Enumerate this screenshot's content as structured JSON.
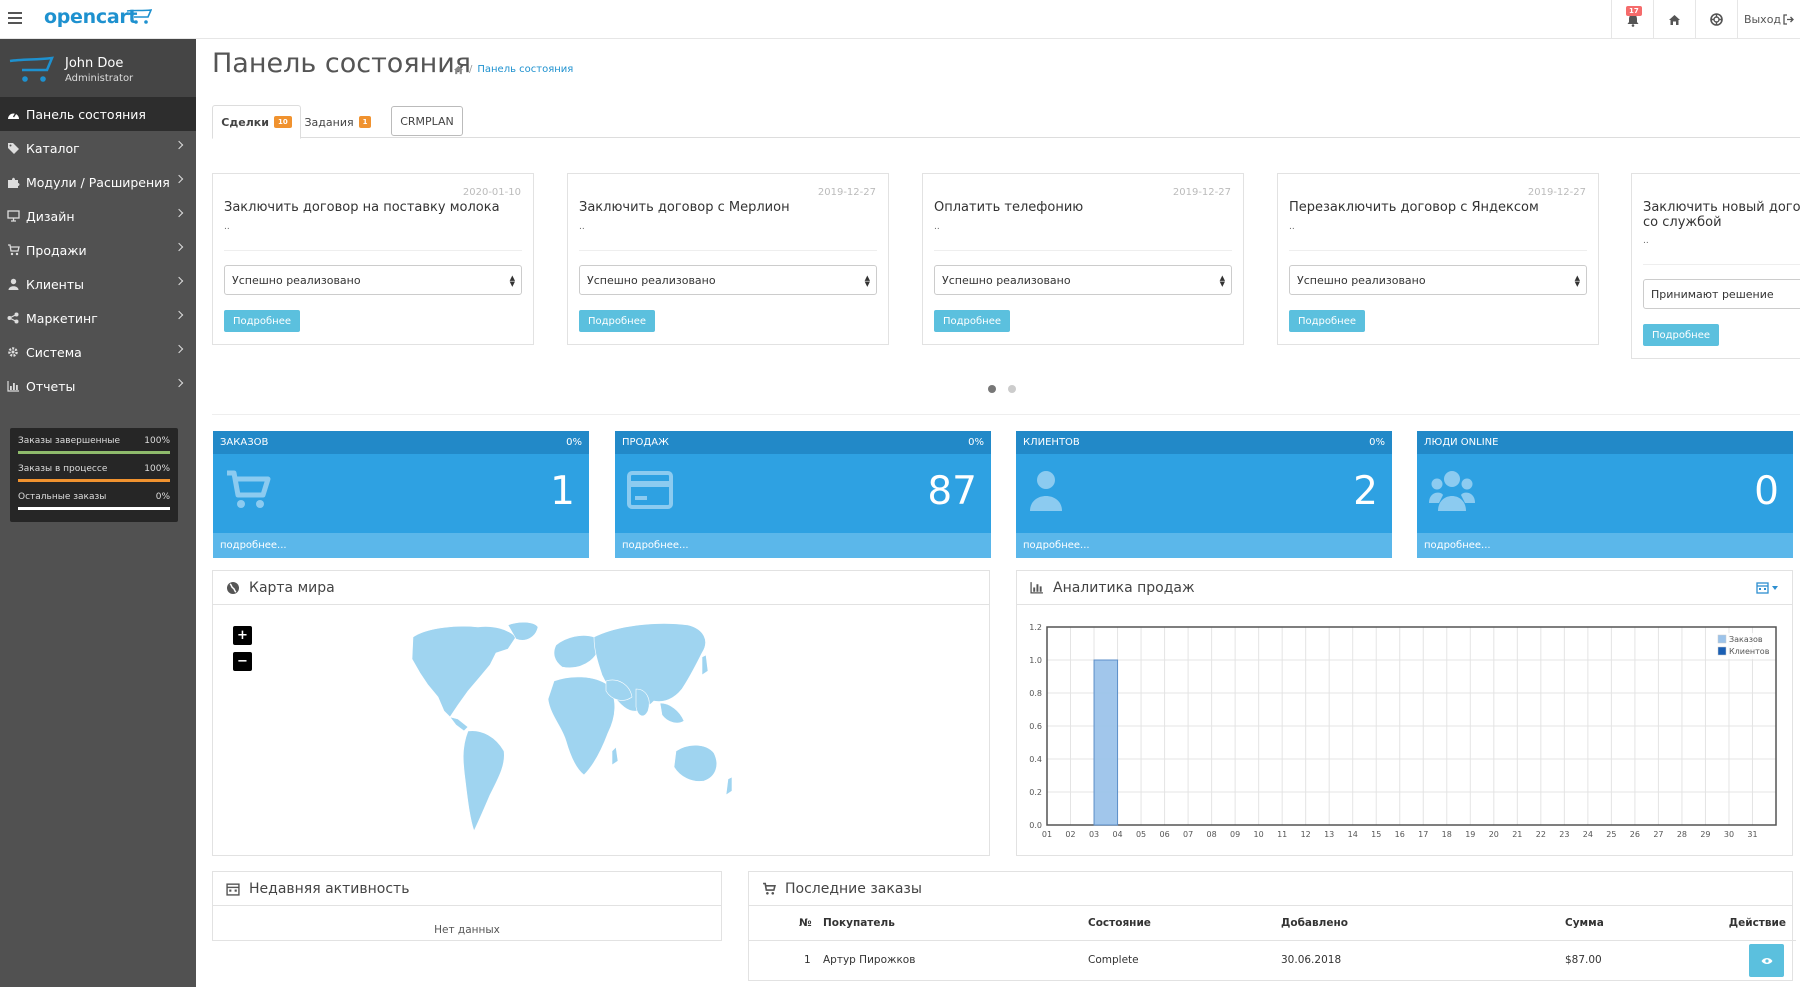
{
  "header": {
    "logo_text": "opencart",
    "notification_count": "17",
    "logout_label": "Выход"
  },
  "sidebar": {
    "user_name": "John Doe",
    "user_role": "Administrator",
    "items": [
      {
        "label": "Панель состояния",
        "icon": "dashboard-icon"
      },
      {
        "label": "Каталог",
        "icon": "tags-icon"
      },
      {
        "label": "Модули / Расширения",
        "icon": "puzzle-icon"
      },
      {
        "label": "Дизайн",
        "icon": "monitor-icon"
      },
      {
        "label": "Продажи",
        "icon": "cart-icon"
      },
      {
        "label": "Клиенты",
        "icon": "user-icon"
      },
      {
        "label": "Маркетинг",
        "icon": "share-icon"
      },
      {
        "label": "Система",
        "icon": "gear-icon"
      },
      {
        "label": "Отчеты",
        "icon": "bar-chart-icon"
      }
    ],
    "stats": [
      {
        "label": "Заказы завершенные",
        "value": "100%",
        "percent": 100,
        "color": "#8fbb6c"
      },
      {
        "label": "Заказы в процессе",
        "value": "100%",
        "percent": 100,
        "color": "#f0922f"
      },
      {
        "label": "Остальные заказы",
        "value": "0%",
        "percent": 0,
        "color": "#ffffff"
      }
    ]
  },
  "page": {
    "title": "Панель состояния",
    "breadcrumb": "Панель состояния"
  },
  "tabs": [
    {
      "label": "Сделки",
      "badge": "10"
    },
    {
      "label": "Задания",
      "badge": "1"
    },
    {
      "label": "CRMPLAN"
    }
  ],
  "cards": [
    {
      "date": "2020-01-10",
      "title": "Заключить договор на поставку молока",
      "note": "..",
      "status": "Успешно реализовано",
      "button": "Подробнее"
    },
    {
      "date": "2019-12-27",
      "title": "Заключить договор с Мерлион",
      "note": "..",
      "status": "Успешно реализовано",
      "button": "Подробнее"
    },
    {
      "date": "2019-12-27",
      "title": "Оплатить телефонию",
      "note": "..",
      "status": "Успешно реализовано",
      "button": "Подробнее"
    },
    {
      "date": "2019-12-27",
      "title": "Перезаключить договор с Яндексом",
      "note": "..",
      "status": "Успешно реализовано",
      "button": "Подробнее"
    },
    {
      "date": "",
      "title": "Заключить новый договор со службой",
      "note": "..",
      "status": "Принимают решение",
      "button": "Подробнее"
    }
  ],
  "tiles": [
    {
      "title": "ЗАКАЗОВ",
      "percent": "0%",
      "value": "1",
      "footer": "подробнее...",
      "icon": "cart-icon"
    },
    {
      "title": "ПРОДАЖ",
      "percent": "0%",
      "value": "87",
      "footer": "подробнее...",
      "icon": "credit-card-icon"
    },
    {
      "title": "КЛИЕНТОВ",
      "percent": "0%",
      "value": "2",
      "footer": "подробнее...",
      "icon": "user-icon"
    },
    {
      "title": "ЛЮДИ ONLINE",
      "percent": "",
      "value": "0",
      "footer": "подробнее...",
      "icon": "users-icon"
    }
  ],
  "map_panel": {
    "title": "Карта мира",
    "zoom_in": "+",
    "zoom_out": "−"
  },
  "chart_panel": {
    "title": "Аналитика продаж"
  },
  "chart_data": {
    "type": "bar",
    "title": "",
    "categories": [
      "01",
      "02",
      "03",
      "04",
      "05",
      "06",
      "07",
      "08",
      "09",
      "10",
      "11",
      "12",
      "13",
      "14",
      "15",
      "16",
      "17",
      "18",
      "19",
      "20",
      "21",
      "22",
      "23",
      "24",
      "25",
      "26",
      "27",
      "28",
      "29",
      "30",
      "31"
    ],
    "series": [
      {
        "name": "Заказов",
        "values": [
          0,
          0,
          1,
          0,
          0,
          0,
          0,
          0,
          0,
          0,
          0,
          0,
          0,
          0,
          0,
          0,
          0,
          0,
          0,
          0,
          0,
          0,
          0,
          0,
          0,
          0,
          0,
          0,
          0,
          0,
          0
        ]
      },
      {
        "name": "Клиентов",
        "values": [
          0,
          0,
          0,
          0,
          0,
          0,
          0,
          0,
          0,
          0,
          0,
          0,
          0,
          0,
          0,
          0,
          0,
          0,
          0,
          0,
          0,
          0,
          0,
          0,
          0,
          0,
          0,
          0,
          0,
          0,
          0
        ]
      }
    ],
    "ylim": [
      0,
      1.2
    ],
    "yticks": [
      "0.0",
      "0.2",
      "0.4",
      "0.6",
      "0.8",
      "1.0",
      "1.2"
    ],
    "grid": true,
    "legend": "top-right",
    "colors": [
      "#9cc3ea",
      "#1a5fb4"
    ]
  },
  "activity_panel": {
    "title": "Недавняя активность",
    "empty": "Нет данных"
  },
  "orders_panel": {
    "title": "Последние заказы",
    "columns": [
      "№",
      "Покупатель",
      "Состояние",
      "Добавлено",
      "Сумма",
      "Действие"
    ],
    "rows": [
      {
        "id": "1",
        "customer": "Артур Пирожков",
        "status": "Complete",
        "date": "30.06.2018",
        "total": "$87.00"
      }
    ]
  }
}
